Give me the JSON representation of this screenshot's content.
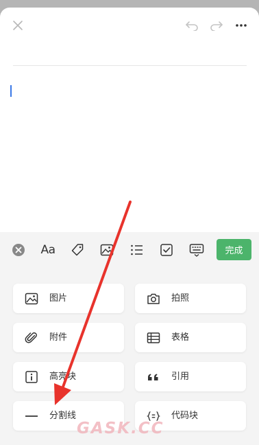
{
  "toolbar": {
    "font_label": "Aa",
    "done_label": "完成",
    "icons": [
      "close-circle-icon",
      "font-icon",
      "tag-icon",
      "image-icon",
      "list-icon",
      "checkbox-icon",
      "keyboard-icon"
    ]
  },
  "insert_menu": {
    "items": [
      {
        "label": "图片",
        "icon": "image-icon"
      },
      {
        "label": "拍照",
        "icon": "camera-icon"
      },
      {
        "label": "附件",
        "icon": "paperclip-icon"
      },
      {
        "label": "表格",
        "icon": "table-icon"
      },
      {
        "label": "高亮块",
        "icon": "info-box-icon"
      },
      {
        "label": "引用",
        "icon": "quote-icon"
      },
      {
        "label": "分割线",
        "icon": "divider-line-icon"
      },
      {
        "label": "代码块",
        "icon": "code-block-icon"
      }
    ]
  },
  "watermark": "GASK.CC",
  "colors": {
    "accent": "#4cb46b",
    "caret": "#3a78e6",
    "arrow": "#e8332c"
  }
}
